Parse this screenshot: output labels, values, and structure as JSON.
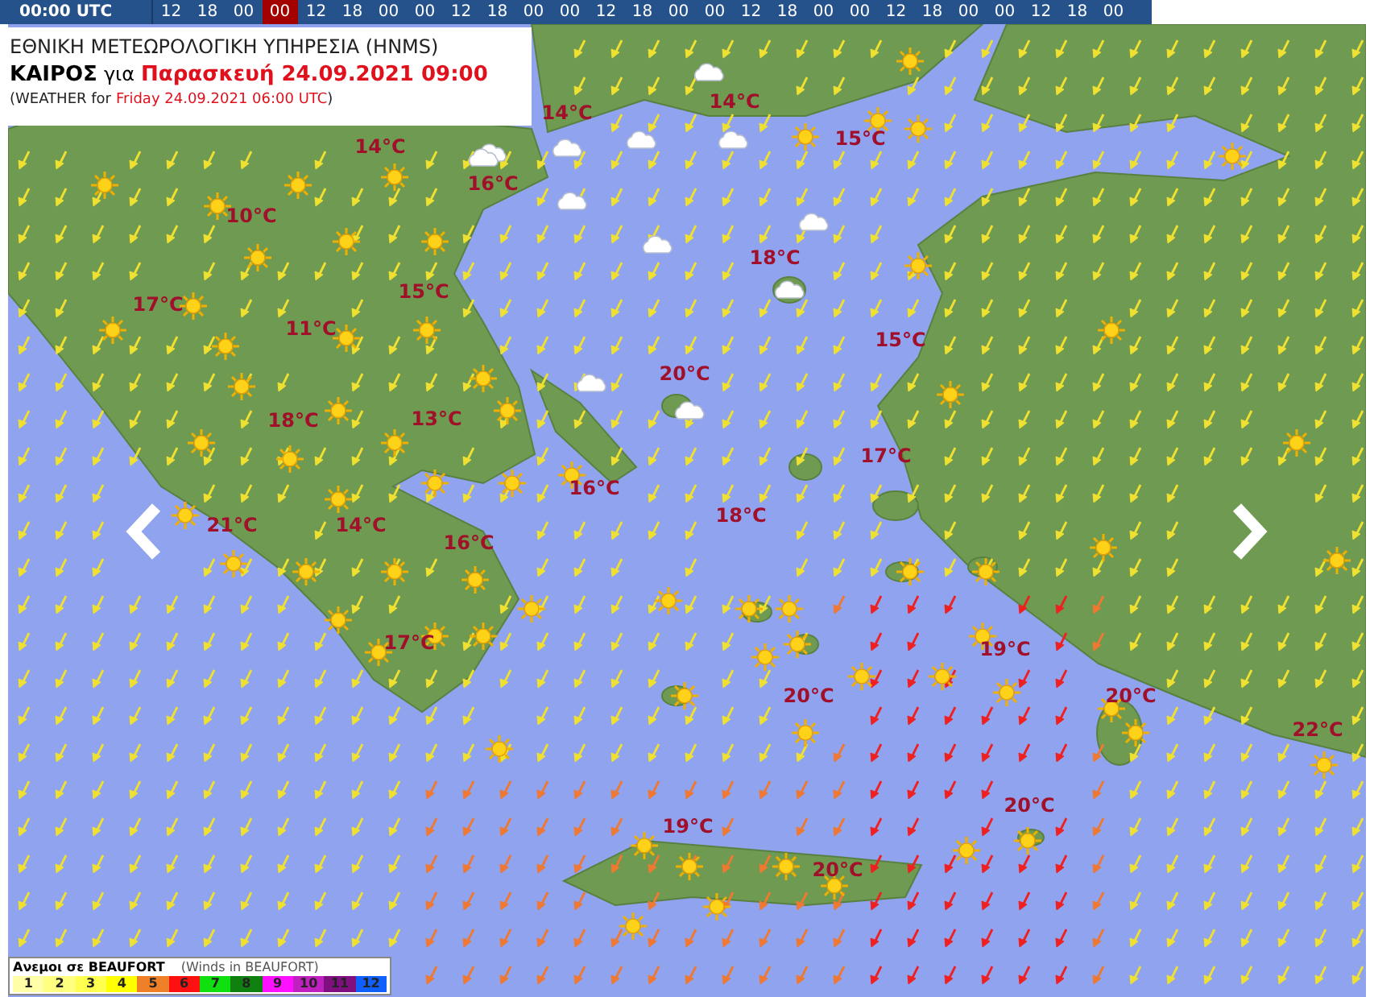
{
  "time_bar": {
    "current": "00:00 UTC",
    "slots": [
      {
        "label": "12",
        "selected": false
      },
      {
        "label": "18",
        "selected": false
      },
      {
        "label": "00",
        "selected": false
      },
      {
        "label": "00",
        "selected": true
      },
      {
        "label": "12",
        "selected": false
      },
      {
        "label": "18",
        "selected": false
      },
      {
        "label": "00",
        "selected": false
      },
      {
        "label": "00",
        "selected": false
      },
      {
        "label": "12",
        "selected": false
      },
      {
        "label": "18",
        "selected": false
      },
      {
        "label": "00",
        "selected": false
      },
      {
        "label": "00",
        "selected": false
      },
      {
        "label": "12",
        "selected": false
      },
      {
        "label": "18",
        "selected": false
      },
      {
        "label": "00",
        "selected": false
      },
      {
        "label": "00",
        "selected": false
      },
      {
        "label": "12",
        "selected": false
      },
      {
        "label": "18",
        "selected": false
      },
      {
        "label": "00",
        "selected": false
      },
      {
        "label": "00",
        "selected": false
      },
      {
        "label": "12",
        "selected": false
      },
      {
        "label": "18",
        "selected": false
      },
      {
        "label": "00",
        "selected": false
      },
      {
        "label": "00",
        "selected": false
      },
      {
        "label": "12",
        "selected": false
      },
      {
        "label": "18",
        "selected": false
      },
      {
        "label": "00",
        "selected": false
      }
    ]
  },
  "header": {
    "agency": "ΕΘΝΙΚΗ ΜΕΤΕΩΡΟΛΟΓΙΚΗ ΥΠΗΡΕΣΙΑ (HNMS)",
    "subject": "ΚΑΙΡΟΣ",
    "connector": "για",
    "local_time": "Παρασκευή 24.09.2021 09:00",
    "utc_prefix": "(WEATHER for",
    "utc_time": "Friday 24.09.2021 06:00 UTC",
    "utc_suffix": ")"
  },
  "map": {
    "temperatures": [
      "14°C",
      "14°C",
      "14°C",
      "15°C",
      "16°C",
      "10°C",
      "18°C",
      "15°C",
      "17°C",
      "11°C",
      "15°C",
      "20°C",
      "18°C",
      "13°C",
      "17°C",
      "16°C",
      "21°C",
      "14°C",
      "16°C",
      "18°C",
      "19°C",
      "17°C",
      "20°C",
      "20°C",
      "22°C",
      "20°C",
      "19°C",
      "20°C"
    ]
  },
  "legend": {
    "title": "Ανεμοι σε BEAUFORT",
    "subtitle": "(Winds in BEAUFORT)",
    "scale": [
      {
        "label": "1",
        "color": "#ffffa8"
      },
      {
        "label": "2",
        "color": "#ffff80"
      },
      {
        "label": "3",
        "color": "#ffff50"
      },
      {
        "label": "4",
        "color": "#ffff00"
      },
      {
        "label": "5",
        "color": "#f08028"
      },
      {
        "label": "6",
        "color": "#ff1010"
      },
      {
        "label": "7",
        "color": "#10e010"
      },
      {
        "label": "8",
        "color": "#108010"
      },
      {
        "label": "9",
        "color": "#ff10ff"
      },
      {
        "label": "10",
        "color": "#c020c0"
      },
      {
        "label": "11",
        "color": "#801080"
      },
      {
        "label": "12",
        "color": "#1060ff"
      }
    ]
  }
}
